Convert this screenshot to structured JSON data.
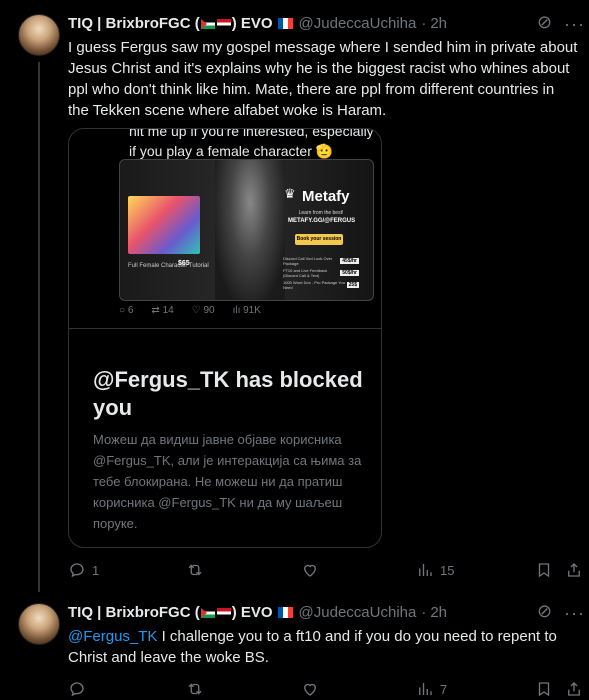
{
  "tweet1": {
    "display_name": "TIQ | BrixbroFGC (",
    "display_name_close": ") EVO",
    "handle": "@JudeccaUchiha",
    "dot": "·",
    "time": "2h",
    "more": "···",
    "text": "I guess Fergus saw my gospel message where I sended him in private about Jesus Christ and it's explains why he is the biggest racist who whines about ppl who don't think like him. Mate, there are ppl from different countries in the Tekken scene where alfabet woke is Haram.",
    "quote": {
      "top_text_line1": "hit me up if you're interested, especially",
      "top_text_line2": "if you play a female character 🫡",
      "promo": {
        "brand": "Metafy",
        "learn_from": "Learn from the best!",
        "url": "METAFY.GG/@FERGUS",
        "book": "Book your session",
        "tutorial_title": "Full Female Character Tutorial",
        "tutorial_price": "$65",
        "rows": [
          {
            "label": "Discord Call Vod Look Over Package",
            "price": "45$/hr"
          },
          {
            "label": "FT10 and Live Feedback (Discord Call & Text)",
            "price": "50$/hr"
          },
          {
            "label": "1000 Word Doc - Pro Package You Need",
            "price": "25$"
          }
        ]
      },
      "stats": {
        "replies": "6",
        "reposts": "14",
        "likes": "90",
        "views": "91K"
      },
      "blocked_title": "@Fergus_TK has blocked you",
      "blocked_body": "Можеш да видиш јавне објаве корисника @Fergus_TK,  али је интеракција са њима за тебе блокирана. Не можеш ни да пратиш корисника @Fergus_TK ни да му шаљеш поруке."
    },
    "actions": {
      "replies": "1",
      "reposts": "",
      "likes": "",
      "views": "15"
    }
  },
  "tweet2": {
    "display_name": "TIQ | BrixbroFGC (",
    "display_name_close": ") EVO",
    "handle": "@JudeccaUchiha",
    "dot": "·",
    "time": "2h",
    "more": "···",
    "mention": "@Fergus_TK",
    "text": " I challenge you to a ft10 and if you do you need to repent to Christ and leave the woke BS.",
    "actions": {
      "views": "7"
    }
  }
}
